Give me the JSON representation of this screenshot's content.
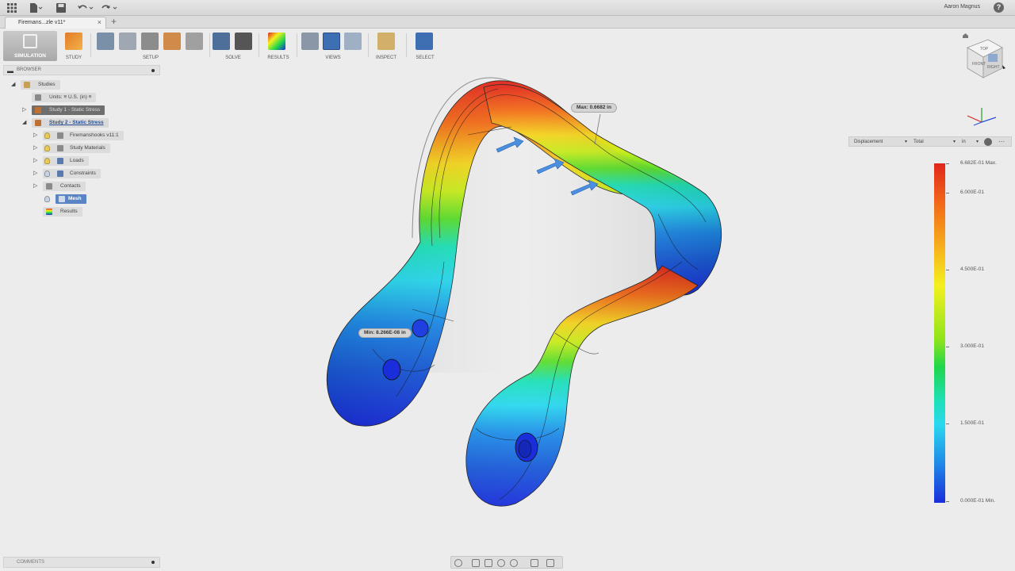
{
  "app": {
    "user_name": "Aaron Magnus",
    "help_glyph": "?"
  },
  "document_tab": {
    "title": "Firemans...zle v11*"
  },
  "ribbon": {
    "workspace_label": "SIMULATION",
    "groups": {
      "study": "STUDY",
      "setup": "SETUP",
      "solve": "SOLVE",
      "results": "RESULTS",
      "views": "VIEWS",
      "inspect": "INSPECT",
      "select": "SELECT"
    }
  },
  "browser": {
    "title": "BROWSER",
    "items": {
      "studies": "Studies",
      "units": "Units: ≡ U.S. (in) ≡",
      "study1": "Study 1 - Static Stress",
      "study2": "Study 2 - Static Stress",
      "model": "Firemanshooks v11:1",
      "materials": "Study Materials",
      "loads": "Loads",
      "constraints": "Constraints",
      "contacts": "Contacts",
      "mesh": "Mesh",
      "results": "Results"
    }
  },
  "comments": {
    "title": "COMMENTS"
  },
  "legend": {
    "result_type": "Displacement",
    "component": "Total",
    "unit": "in",
    "labels": {
      "max": "6.682E-01 Max.",
      "l5": "6.000E-01",
      "l4": "4.500E-01",
      "l3": "3.000E-01",
      "l2": "1.500E-01",
      "min": "0.000E-01 Min."
    },
    "colors": {
      "max": "#e0261c",
      "mid": "#8ee41c",
      "min": "#1a2ddb"
    }
  },
  "probes": {
    "max": "Max: 0.6682 in",
    "min": "Min: 8.266E-08 in"
  },
  "viewcube": {
    "faces": [
      "FRONT",
      "RIGHT",
      "TOP"
    ]
  }
}
